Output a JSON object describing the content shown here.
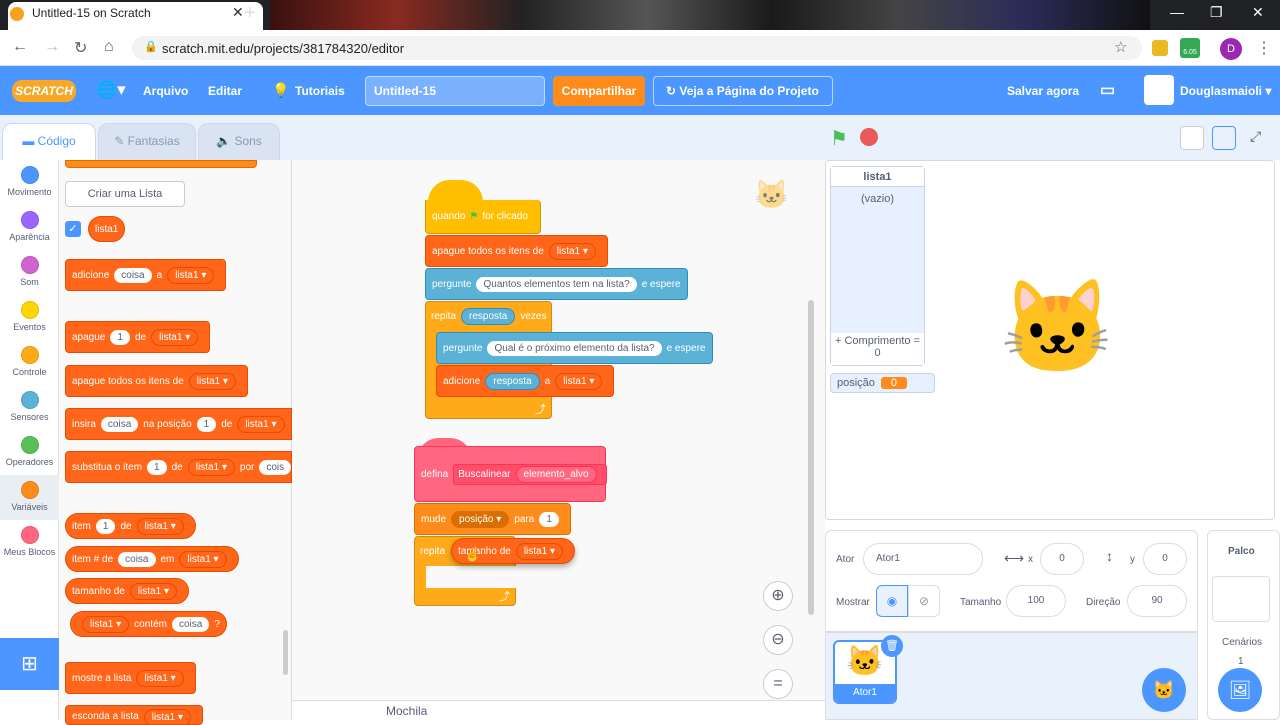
{
  "browser": {
    "tab_title": "Untitled-15 on Scratch",
    "url": "scratch.mit.edu/projects/381784320/editor",
    "profile_initial": "D",
    "extension_badge": "6.05"
  },
  "menubar": {
    "logo": "SCRATCH",
    "file": "Arquivo",
    "edit": "Editar",
    "tutorials": "Tutoriais",
    "project_title": "Untitled-15",
    "share": "Compartilhar",
    "see_project": "Veja a Página do Projeto",
    "save_now": "Salvar agora",
    "username": "Douglasmaioli"
  },
  "tabs": {
    "code": "Código",
    "costumes": "Fantasias",
    "sounds": "Sons"
  },
  "categories": [
    {
      "label": "Movimento",
      "color": "#4c97ff"
    },
    {
      "label": "Aparência",
      "color": "#9966ff"
    },
    {
      "label": "Som",
      "color": "#cf63cf"
    },
    {
      "label": "Eventos",
      "color": "#ffd500"
    },
    {
      "label": "Controle",
      "color": "#ffab19"
    },
    {
      "label": "Sensores",
      "color": "#5cb1d6"
    },
    {
      "label": "Operadores",
      "color": "#59c059"
    },
    {
      "label": "Variáveis",
      "color": "#ff8c1a"
    },
    {
      "label": "Meus Blocos",
      "color": "#ff6680"
    }
  ],
  "palette": {
    "make_list": "Criar uma Lista",
    "list_name": "lista1",
    "add": "adicione",
    "thing": "coisa",
    "to": "a",
    "delete": "apague",
    "one": "1",
    "of": "de",
    "delete_all": "apague todos os itens de",
    "insert": "insira",
    "at_position": "na posição",
    "replace_item": "substitua o item",
    "with": "por",
    "thing_cut": "cois",
    "item": "item",
    "item_num": "item # de",
    "in": "em",
    "length_of": "tamanho de",
    "contains": "contém",
    "question": "?",
    "show_list": "mostre a lista",
    "hide_list": "esconda a lista"
  },
  "script1": {
    "when": "quando",
    "clicked": "for clicado",
    "delete_all": "apague todos os itens de",
    "list": "lista1",
    "ask": "pergunte",
    "ask_q1": "Quantos elementos tem na lista?",
    "and_wait": "e espere",
    "repeat": "repita",
    "answer": "resposta",
    "times": "vezes",
    "ask_q2": "Qual é o próximo elemento da lista?",
    "add": "adicione",
    "to": "a"
  },
  "script2": {
    "define": "defina",
    "proc_name": "Buscalinear",
    "param": "elemento_alvo",
    "set": "mude",
    "var": "posição",
    "to": "para",
    "val": "1",
    "repeat": "repita",
    "length_of": "tamanho de",
    "list": "lista1"
  },
  "workspace": {
    "backpack": "Mochila"
  },
  "stage": {
    "list_title": "lista1",
    "list_empty": "(vazio)",
    "list_length": "+ Comprimento = 0",
    "var_name": "posição",
    "var_value": "0"
  },
  "sprite_info": {
    "sprite_label": "Ator",
    "sprite_name": "Ator1",
    "x_label": "x",
    "x": "0",
    "y_label": "y",
    "y": "0",
    "show_label": "Mostrar",
    "size_label": "Tamanho",
    "size": "100",
    "direction_label": "Direção",
    "direction": "90"
  },
  "sprite_list": {
    "sprite_name": "Ator1"
  },
  "stage_panel": {
    "title": "Palco",
    "backdrops": "Cenários",
    "backdrop_count": "1"
  }
}
